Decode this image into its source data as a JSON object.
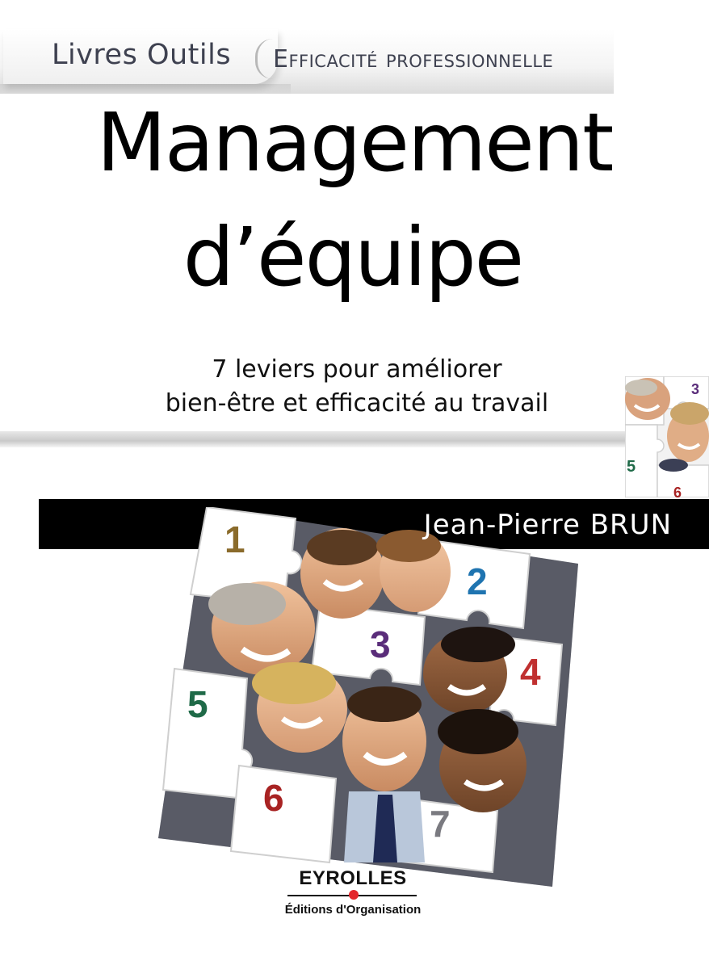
{
  "series": {
    "name": "Livres Outils",
    "collection": "Efficacité professionnelle"
  },
  "title": {
    "line1": "Management",
    "line2": "d’équipe"
  },
  "subtitle": {
    "line1": "7 leviers pour améliorer",
    "line2": "bien-être et efficacité au travail"
  },
  "author": "Jean-Pierre BRUN",
  "puzzle_numbers": [
    "1",
    "2",
    "3",
    "4",
    "5",
    "6",
    "7"
  ],
  "corner_numbers": [
    "3",
    "5",
    "6"
  ],
  "publisher": {
    "name": "EYROLLES",
    "imprint": "Éditions d'Organisation"
  },
  "colors": {
    "author_bar": "#000000",
    "series_text": "#3e4150",
    "publisher_dot": "#e3262b",
    "num_1": "#8a6b2b",
    "num_2": "#1f74b0",
    "num_3": "#5a2d7a",
    "num_4": "#c03030",
    "num_5": "#1f6a48",
    "num_6": "#a82323",
    "num_7": "#7a7a80"
  }
}
